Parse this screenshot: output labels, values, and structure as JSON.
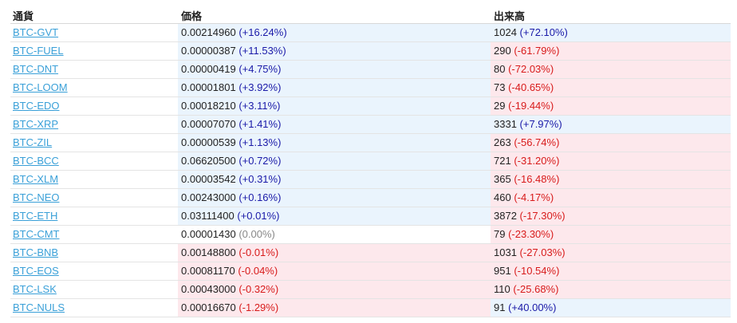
{
  "colors": {
    "positive": "#1a1aa8",
    "negative": "#d81b1b",
    "neutral": "#888888",
    "link": "#3aa0d8"
  },
  "headers": {
    "currency": "通貨",
    "price": "価格",
    "volume": "出来高"
  },
  "rows": [
    {
      "pair": "BTC-GVT",
      "price": "0.00214960",
      "price_change": "(+16.24%)",
      "price_dir": "pos",
      "volume": "1024",
      "volume_change": "(+72.10%)",
      "volume_dir": "pos"
    },
    {
      "pair": "BTC-FUEL",
      "price": "0.00000387",
      "price_change": "(+11.53%)",
      "price_dir": "pos",
      "volume": "290",
      "volume_change": "(-61.79%)",
      "volume_dir": "neg"
    },
    {
      "pair": "BTC-DNT",
      "price": "0.00000419",
      "price_change": "(+4.75%)",
      "price_dir": "pos",
      "volume": "80",
      "volume_change": "(-72.03%)",
      "volume_dir": "neg"
    },
    {
      "pair": "BTC-LOOM",
      "price": "0.00001801",
      "price_change": "(+3.92%)",
      "price_dir": "pos",
      "volume": "73",
      "volume_change": "(-40.65%)",
      "volume_dir": "neg"
    },
    {
      "pair": "BTC-EDO",
      "price": "0.00018210",
      "price_change": "(+3.11%)",
      "price_dir": "pos",
      "volume": "29",
      "volume_change": "(-19.44%)",
      "volume_dir": "neg"
    },
    {
      "pair": "BTC-XRP",
      "price": "0.00007070",
      "price_change": "(+1.41%)",
      "price_dir": "pos",
      "volume": "3331",
      "volume_change": "(+7.97%)",
      "volume_dir": "pos"
    },
    {
      "pair": "BTC-ZIL",
      "price": "0.00000539",
      "price_change": "(+1.13%)",
      "price_dir": "pos",
      "volume": "263",
      "volume_change": "(-56.74%)",
      "volume_dir": "neg"
    },
    {
      "pair": "BTC-BCC",
      "price": "0.06620500",
      "price_change": "(+0.72%)",
      "price_dir": "pos",
      "volume": "721",
      "volume_change": "(-31.20%)",
      "volume_dir": "neg"
    },
    {
      "pair": "BTC-XLM",
      "price": "0.00003542",
      "price_change": "(+0.31%)",
      "price_dir": "pos",
      "volume": "365",
      "volume_change": "(-16.48%)",
      "volume_dir": "neg"
    },
    {
      "pair": "BTC-NEO",
      "price": "0.00243000",
      "price_change": "(+0.16%)",
      "price_dir": "pos",
      "volume": "460",
      "volume_change": "(-4.17%)",
      "volume_dir": "neg"
    },
    {
      "pair": "BTC-ETH",
      "price": "0.03111400",
      "price_change": "(+0.01%)",
      "price_dir": "pos",
      "volume": "3872",
      "volume_change": "(-17.30%)",
      "volume_dir": "neg"
    },
    {
      "pair": "BTC-CMT",
      "price": "0.00001430",
      "price_change": "(0.00%)",
      "price_dir": "zero",
      "volume": "79",
      "volume_change": "(-23.30%)",
      "volume_dir": "neg"
    },
    {
      "pair": "BTC-BNB",
      "price": "0.00148800",
      "price_change": "(-0.01%)",
      "price_dir": "neg",
      "volume": "1031",
      "volume_change": "(-27.03%)",
      "volume_dir": "neg"
    },
    {
      "pair": "BTC-EOS",
      "price": "0.00081170",
      "price_change": "(-0.04%)",
      "price_dir": "neg",
      "volume": "951",
      "volume_change": "(-10.54%)",
      "volume_dir": "neg"
    },
    {
      "pair": "BTC-LSK",
      "price": "0.00043000",
      "price_change": "(-0.32%)",
      "price_dir": "neg",
      "volume": "110",
      "volume_change": "(-25.68%)",
      "volume_dir": "neg"
    },
    {
      "pair": "BTC-NULS",
      "price": "0.00016670",
      "price_change": "(-1.29%)",
      "price_dir": "neg",
      "volume": "91",
      "volume_change": "(+40.00%)",
      "volume_dir": "pos"
    }
  ]
}
